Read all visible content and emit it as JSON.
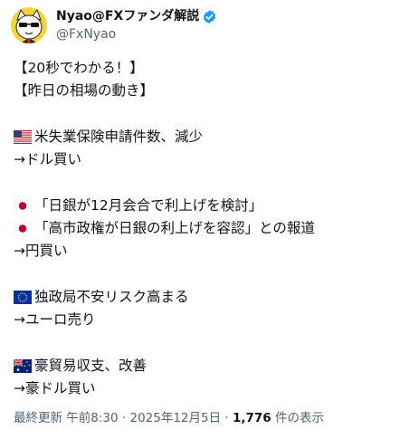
{
  "author": {
    "display_name": "Nyao@FXファンダ解説",
    "handle": "@FxNyao",
    "verified_icon": "verified-badge-icon",
    "avatar_icon": "cat-avatar-icon"
  },
  "tweet": {
    "lines": {
      "l1": "【20秒でわかる！】",
      "l2": "【昨日の相場の動き】",
      "l3": "米失業保険申請件数、減少",
      "l4": "→ドル買い",
      "l5": "「日銀が12月会合で利上げを検討」",
      "l6": "「高市政権が日銀の利上げを容認」との報道",
      "l7": "→円買い",
      "l8": "独政局不安リスク高まる",
      "l9": "→ユーロ売り",
      "l10": "豪貿易収支、改善",
      "l11": "→豪ドル買い"
    },
    "flags": {
      "us": "us-flag-icon",
      "jp": "japan-flag-icon",
      "eu": "eu-flag-icon",
      "au": "australia-flag-icon"
    }
  },
  "meta": {
    "prefix": "最終更新 午前8:30 · 2025年12月5日 · ",
    "view_count": "1,776",
    "suffix": " 件の表示"
  },
  "colors": {
    "text": "#0f1419",
    "secondary": "#536471",
    "verified": "#1d9bf0",
    "avatar_bg": "#f4d23a"
  }
}
